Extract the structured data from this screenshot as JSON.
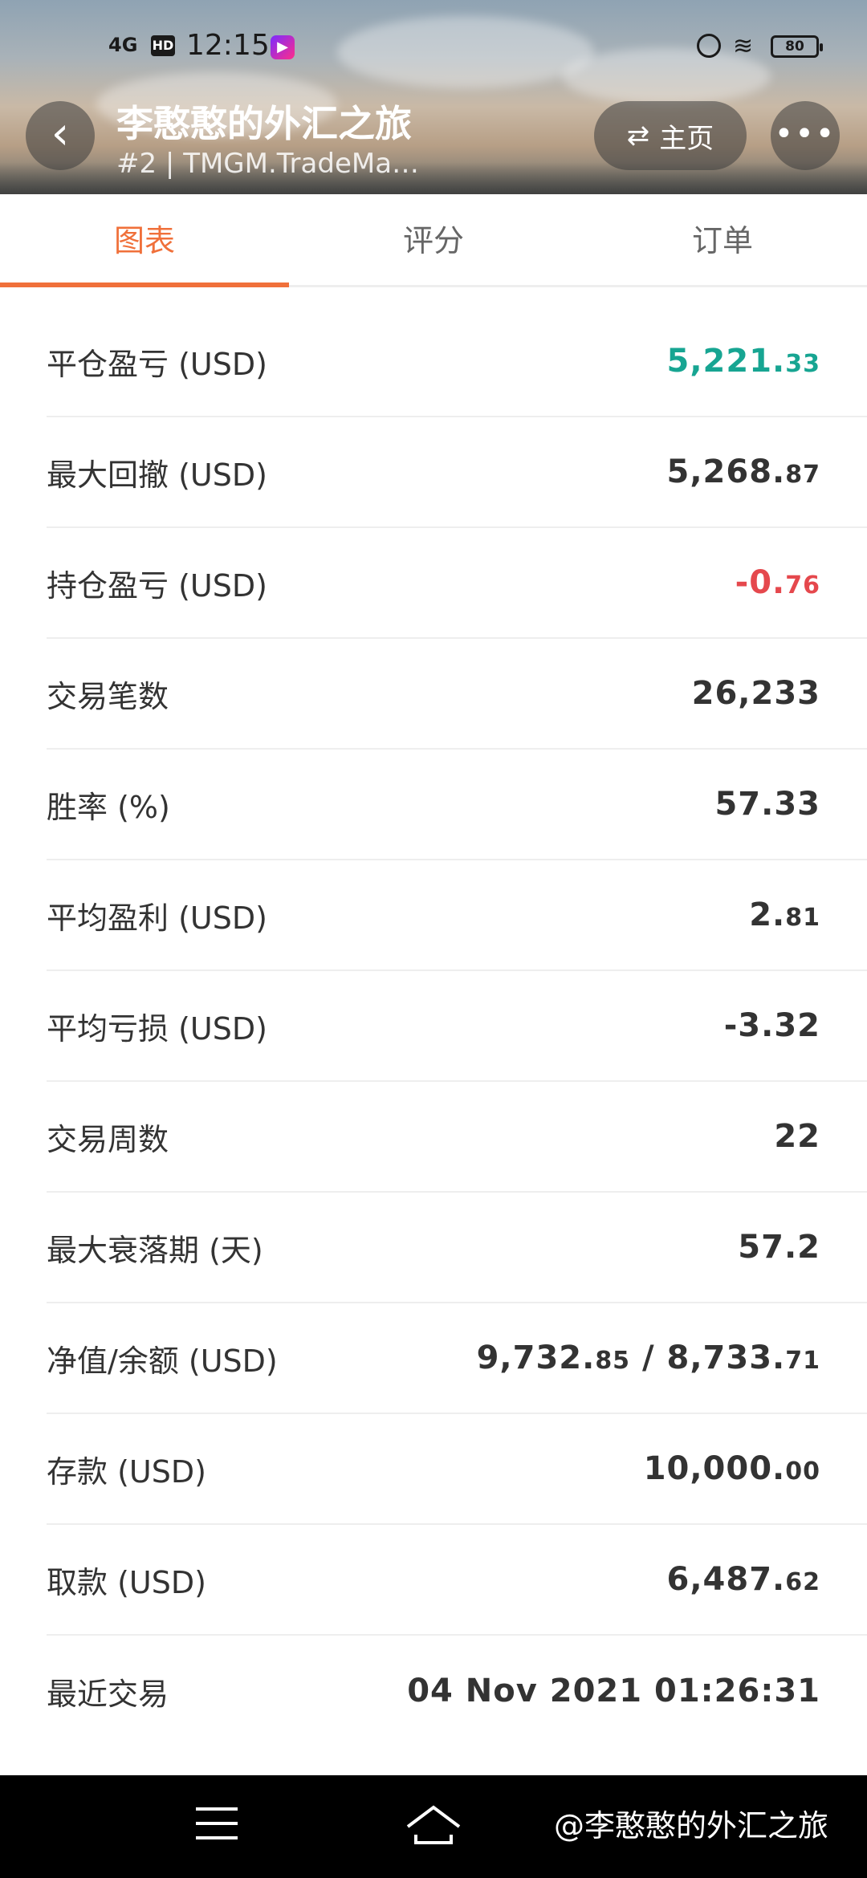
{
  "status_bar": {
    "signal": "4G",
    "hd": "HD",
    "time": "12:15",
    "battery": "80"
  },
  "header": {
    "title": "李憨憨的外汇之旅",
    "subtitle": "#2 | TMGM.TradeMa…",
    "home_label": "主页"
  },
  "tabs": [
    {
      "label": "图表",
      "active": true
    },
    {
      "label": "评分",
      "active": false
    },
    {
      "label": "订单",
      "active": false
    }
  ],
  "stats": [
    {
      "label": "平仓盈亏 (USD)",
      "int": "5,221.",
      "dec": "33",
      "tone": "green"
    },
    {
      "label": "最大回撤 (USD)",
      "int": "5,268.",
      "dec": "87",
      "tone": "normal"
    },
    {
      "label": "持仓盈亏 (USD)",
      "int": "-0.",
      "dec": "76",
      "tone": "red"
    },
    {
      "label": "交易笔数",
      "int": "26,233",
      "dec": "",
      "tone": "normal"
    },
    {
      "label": "胜率 (%)",
      "int": "57.33",
      "dec": "",
      "tone": "normal"
    },
    {
      "label": "平均盈利 (USD)",
      "int": "2.",
      "dec": "81",
      "tone": "normal"
    },
    {
      "label": "平均亏损 (USD)",
      "int": "-3.32",
      "dec": "",
      "tone": "normal"
    },
    {
      "label": "交易周数",
      "int": "22",
      "dec": "",
      "tone": "normal"
    },
    {
      "label": "最大衰落期 (天)",
      "int": "57.2",
      "dec": "",
      "tone": "normal"
    },
    {
      "label": "净值/余额 (USD)",
      "int": "9,732.",
      "dec": "85",
      "int2": " / 8,733.",
      "dec2": "71",
      "tone": "normal"
    },
    {
      "label": "存款 (USD)",
      "int": "10,000.",
      "dec": "00",
      "tone": "normal"
    },
    {
      "label": "取款 (USD)",
      "int": "6,487.",
      "dec": "62",
      "tone": "normal"
    },
    {
      "label": "最近交易",
      "int": "04 Nov 2021 01:26:31",
      "dec": "",
      "tone": "normal"
    }
  ],
  "watermark": "@李憨憨的外汇之旅",
  "colors": {
    "accent": "#f0703a",
    "positive": "#17a592",
    "negative": "#e5484d"
  }
}
